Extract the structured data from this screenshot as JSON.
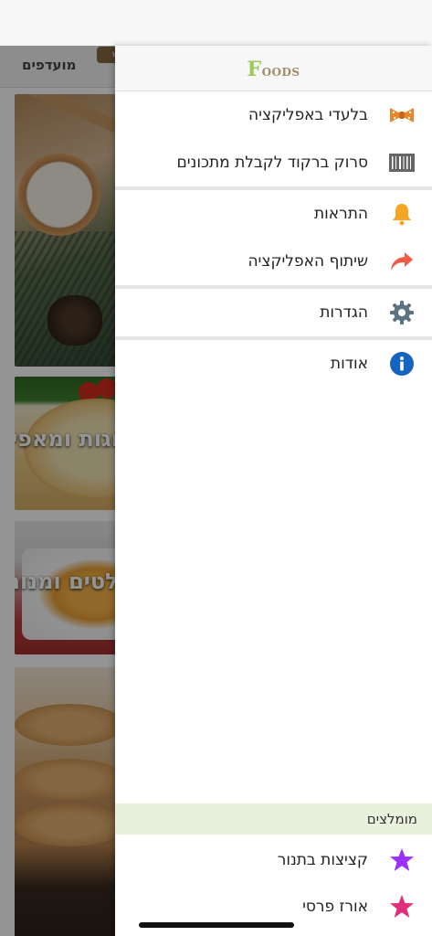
{
  "background": {
    "tab_label": "מועדפים",
    "new_badge": "חדש",
    "cards": [
      {
        "title": ""
      },
      {
        "title": "עוגות ומאפים לפשט וכל הימים - מחמאות וחידות"
      },
      {
        "title": "סלטים ומנות - עיקריות פסטות"
      },
      {
        "title": ""
      }
    ]
  },
  "drawer": {
    "logo_first": "F",
    "logo_rest": "oods",
    "groups": [
      [
        {
          "label": "בלעדי באפליקציה",
          "icon": "bow-tie-icon"
        },
        {
          "label": "סרוק ברקוד לקבלת מתכונים",
          "icon": "barcode-icon"
        }
      ],
      [
        {
          "label": "התראות",
          "icon": "bell-icon"
        },
        {
          "label": "שיתוף האפליקציה",
          "icon": "share-arrow-icon"
        }
      ],
      [
        {
          "label": "הגדרות",
          "icon": "gear-icon"
        }
      ],
      [
        {
          "label": "אודות",
          "icon": "info-icon"
        }
      ]
    ],
    "recommended": {
      "header": "מומלצים",
      "items": [
        {
          "label": "קציצות בתנור",
          "icon": "star-icon",
          "color": "#9b30ff"
        },
        {
          "label": "אורז פרסי",
          "icon": "star-icon",
          "color": "#e0307a"
        }
      ]
    }
  },
  "colors": {
    "bell": "#f5a623",
    "share": "#f25a45",
    "gear": "#5d7480",
    "info": "#1565c0",
    "bowtie": "#e8842a"
  }
}
